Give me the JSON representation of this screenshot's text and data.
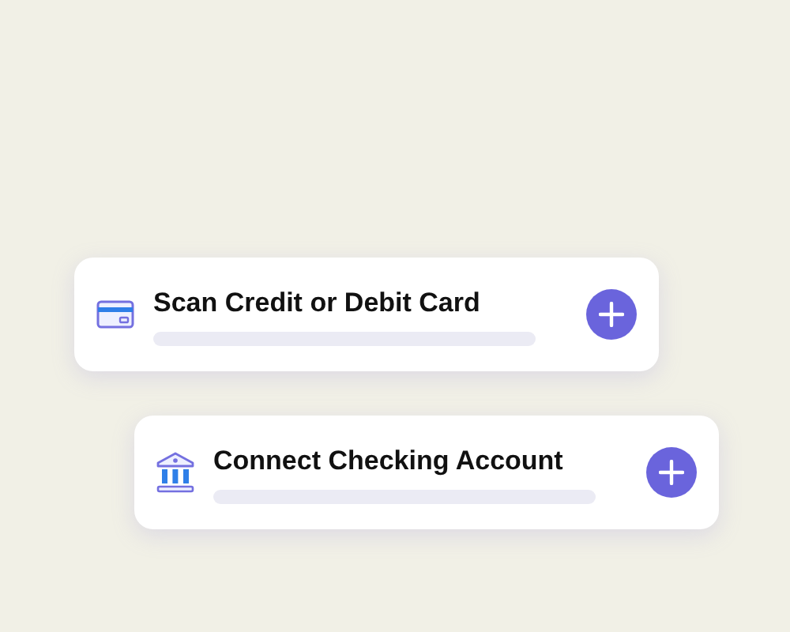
{
  "options": [
    {
      "kind": "card",
      "title": "Scan Credit or Debit Card"
    },
    {
      "kind": "bank",
      "title": "Connect Checking Account"
    }
  ]
}
